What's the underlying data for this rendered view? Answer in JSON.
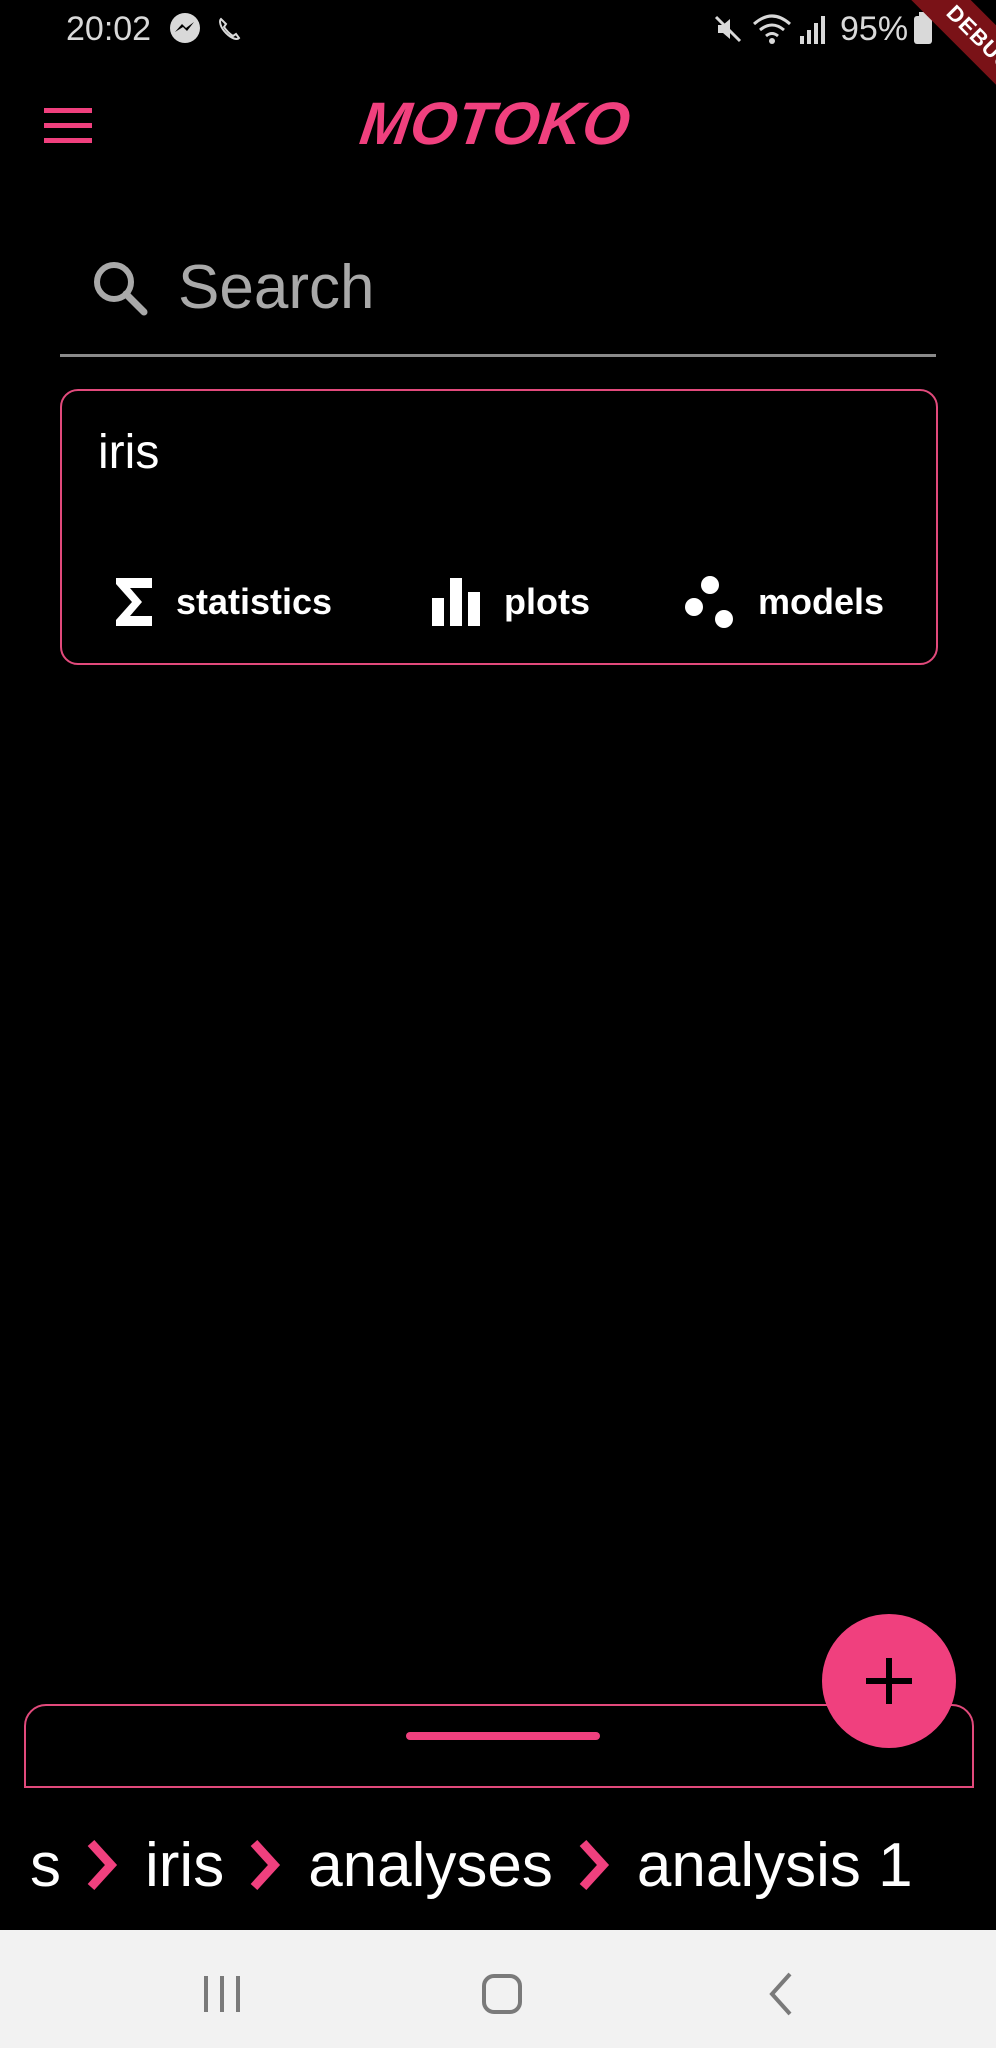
{
  "status_bar": {
    "time": "20:02",
    "battery": "95%",
    "icons": [
      "messenger-icon",
      "call-icon",
      "mute-icon",
      "wifi-icon",
      "signal-icon",
      "battery-icon"
    ]
  },
  "debug_banner": "DEBUG",
  "app_bar": {
    "brand": "MOTOKO",
    "accent_color": "#f0407e"
  },
  "search": {
    "placeholder": "Search",
    "value": ""
  },
  "project_card": {
    "title": "iris",
    "actions": [
      {
        "label": "statistics",
        "icon": "sigma-icon"
      },
      {
        "label": "plots",
        "icon": "bar-chart-icon"
      },
      {
        "label": "models",
        "icon": "scatter-dots-icon"
      }
    ]
  },
  "fab": {
    "icon": "plus-icon"
  },
  "breadcrumb": {
    "items": [
      "s",
      "iris",
      "analyses",
      "analysis 1"
    ]
  },
  "nav_bar": {
    "buttons": [
      "recent-apps",
      "home",
      "back"
    ]
  }
}
